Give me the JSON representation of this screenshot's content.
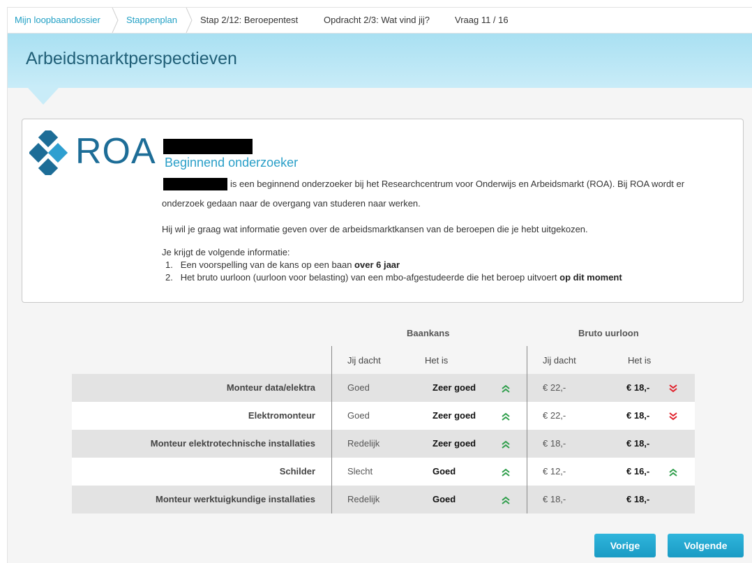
{
  "breadcrumb": {
    "items": [
      {
        "label": "Mijn loopbaandossier"
      },
      {
        "label": "Stappenplan"
      },
      {
        "label": "Stap 2/12: Beroepentest"
      },
      {
        "label": "Opdracht 2/3: Wat vind jij?"
      },
      {
        "label": "Vraag 11 / 16"
      }
    ]
  },
  "header": {
    "title": "Arbeidsmarktperspectieven"
  },
  "intro": {
    "logo_text": "ROA",
    "role": "Beginnend onderzoeker",
    "para1_a": "is een beginnend onderzoeker bij het Researchcentrum voor Onderwijs en Arbeidsmarkt (ROA). Bij ROA wordt er",
    "para1_b": "onderzoek gedaan naar de overgang van studeren naar werken.",
    "para2": "Hij wil je graag wat informatie geven over de arbeidsmarktkansen van de beroepen die je hebt uitgekozen.",
    "para3": "Je krijgt de volgende informatie:",
    "list": [
      {
        "num": "1.",
        "text": "Een voorspelling van de kans op een baan ",
        "bold": "over 6 jaar"
      },
      {
        "num": "2.",
        "text": "Het bruto uurloon (uurloon voor belasting) van een mbo-afgestudeerde die het beroep uitvoert ",
        "bold": "op dit moment"
      }
    ]
  },
  "table": {
    "group1": "Baankans",
    "group2": "Bruto uurloon",
    "sub_thought": "Jij dacht",
    "sub_is": "Het is",
    "rows": [
      {
        "name": "Monteur data/elektra",
        "kans_dacht": "Goed",
        "kans_is": "Zeer goed",
        "kans_trend": "up",
        "loon_dacht": "€ 22,-",
        "loon_is": "€ 18,-",
        "loon_trend": "down"
      },
      {
        "name": "Elektromonteur",
        "kans_dacht": "Goed",
        "kans_is": "Zeer goed",
        "kans_trend": "up",
        "loon_dacht": "€ 22,-",
        "loon_is": "€ 18,-",
        "loon_trend": "down"
      },
      {
        "name": "Monteur elektrotechnische installaties",
        "kans_dacht": "Redelijk",
        "kans_is": "Zeer goed",
        "kans_trend": "up",
        "loon_dacht": "€ 18,-",
        "loon_is": "€ 18,-",
        "loon_trend": "none"
      },
      {
        "name": "Schilder",
        "kans_dacht": "Slecht",
        "kans_is": "Goed",
        "kans_trend": "up",
        "loon_dacht": "€ 12,-",
        "loon_is": "€ 16,-",
        "loon_trend": "up"
      },
      {
        "name": "Monteur werktuigkundige installaties",
        "kans_dacht": "Redelijk",
        "kans_is": "Goed",
        "kans_trend": "up",
        "loon_dacht": "€ 18,-",
        "loon_is": "€ 18,-",
        "loon_trend": "none"
      }
    ]
  },
  "buttons": {
    "prev": "Vorige",
    "next": "Volgende"
  },
  "colors": {
    "accent": "#1f9fc4",
    "up": "#2e9e4a",
    "down": "#e0202a",
    "band": "#bfe8f6"
  }
}
